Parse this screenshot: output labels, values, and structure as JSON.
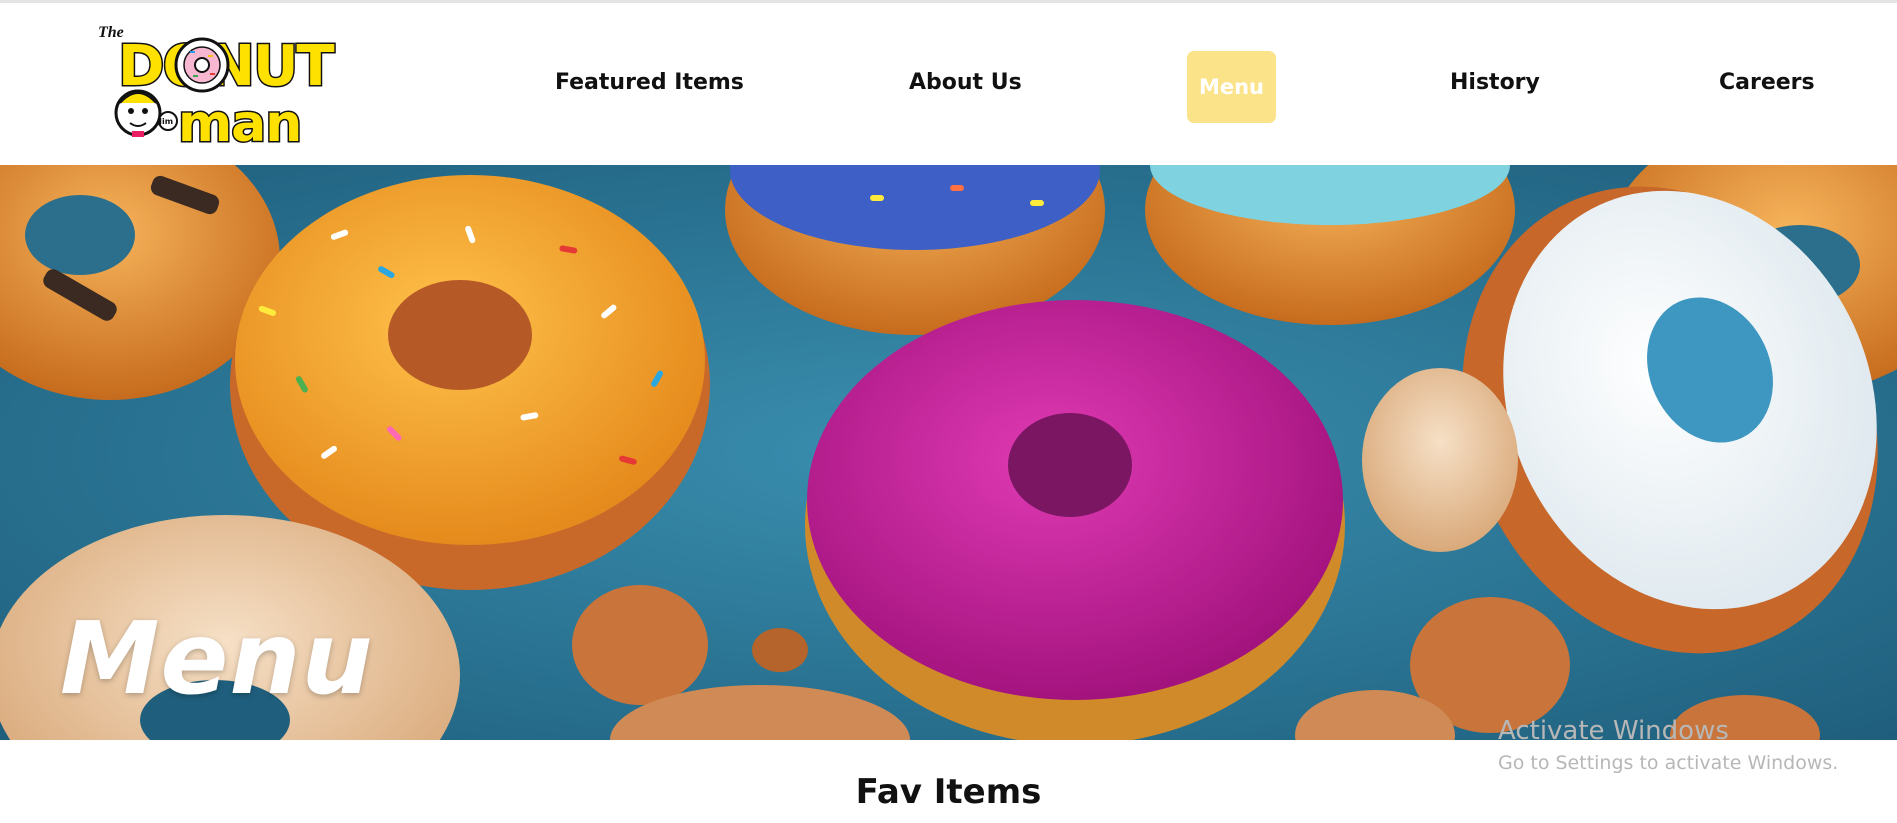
{
  "logo": {
    "icon": "donut-man-logo",
    "text_top": "The",
    "text_mid": "DONUT",
    "text_bottom": "man",
    "badge": "Jim"
  },
  "nav": {
    "items": [
      {
        "label": "Featured Items"
      },
      {
        "label": "About Us"
      },
      {
        "label": "Menu",
        "active": true
      },
      {
        "label": "History"
      },
      {
        "label": "Careers"
      }
    ]
  },
  "hero": {
    "title": "Menu"
  },
  "section": {
    "title": "Fav Items"
  },
  "watermark": {
    "line1": "Activate Windows",
    "line2": "Go to Settings to activate Windows."
  },
  "colors": {
    "active_nav_bg": "#fbe38a",
    "hero_bg": "#2f7f9f",
    "logo_yellow": "#ffe100"
  }
}
